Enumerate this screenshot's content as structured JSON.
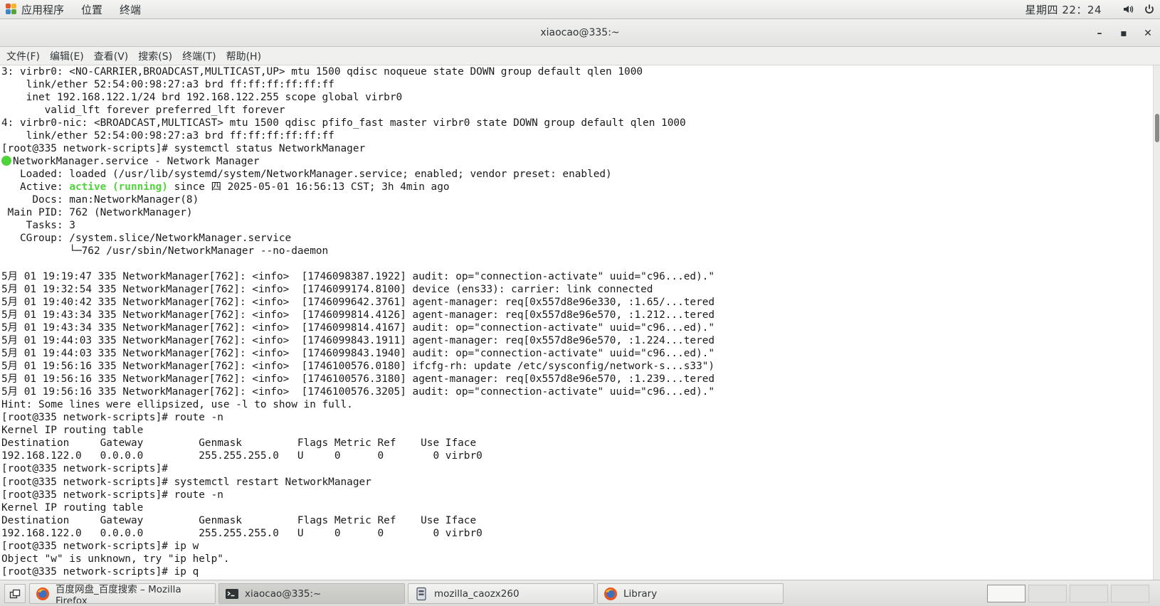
{
  "topbar": {
    "applications": "应用程序",
    "places": "位置",
    "terminal": "终端",
    "clock": "星期四 22：24",
    "volume_icon": "volume-icon",
    "power_icon": "power-icon"
  },
  "window": {
    "title": "xiaocao@335:~",
    "minimize": "–",
    "maximize": "▪",
    "close": "✕"
  },
  "menu": [
    "文件(F)",
    "编辑(E)",
    "查看(V)",
    "搜索(S)",
    "终端(T)",
    "帮助(H)"
  ],
  "terminal_lines": [
    "3: virbr0: <NO-CARRIER,BROADCAST,MULTICAST,UP> mtu 1500 qdisc noqueue state DOWN group default qlen 1000",
    "    link/ether 52:54:00:98:27:a3 brd ff:ff:ff:ff:ff:ff",
    "    inet 192.168.122.1/24 brd 192.168.122.255 scope global virbr0",
    "       valid_lft forever preferred_lft forever",
    "4: virbr0-nic: <BROADCAST,MULTICAST> mtu 1500 qdisc pfifo_fast master virbr0 state DOWN group default qlen 1000",
    "    link/ether 52:54:00:98:27:a3 brd ff:ff:ff:ff:ff:ff",
    "[root@335 network-scripts]# systemctl status NetworkManager",
    "NetworkManager.service - Network Manager",
    "   Loaded: loaded (/usr/lib/systemd/system/NetworkManager.service; enabled; vendor preset: enabled)",
    "   Active: ",
    "active (running)",
    " since 四 2025-05-01 16:56:13 CST; 3h 4min ago",
    "     Docs: man:NetworkManager(8)",
    " Main PID: 762 (NetworkManager)",
    "    Tasks: 3",
    "   CGroup: /system.slice/NetworkManager.service",
    "           └─762 /usr/sbin/NetworkManager --no-daemon",
    "",
    "5月 01 19:19:47 335 NetworkManager[762]: <info>  [1746098387.1922] audit: op=\"connection-activate\" uuid=\"c96...ed).\"",
    "5月 01 19:32:54 335 NetworkManager[762]: <info>  [1746099174.8100] device (ens33): carrier: link connected",
    "5月 01 19:40:42 335 NetworkManager[762]: <info>  [1746099642.3761] agent-manager: req[0x557d8e96e330, :1.65/...tered",
    "5月 01 19:43:34 335 NetworkManager[762]: <info>  [1746099814.4126] agent-manager: req[0x557d8e96e570, :1.212...tered",
    "5月 01 19:43:34 335 NetworkManager[762]: <info>  [1746099814.4167] audit: op=\"connection-activate\" uuid=\"c96...ed).\"",
    "5月 01 19:44:03 335 NetworkManager[762]: <info>  [1746099843.1911] agent-manager: req[0x557d8e96e570, :1.224...tered",
    "5月 01 19:44:03 335 NetworkManager[762]: <info>  [1746099843.1940] audit: op=\"connection-activate\" uuid=\"c96...ed).\"",
    "5月 01 19:56:16 335 NetworkManager[762]: <info>  [1746100576.0180] ifcfg-rh: update /etc/sysconfig/network-s...s33\")",
    "5月 01 19:56:16 335 NetworkManager[762]: <info>  [1746100576.3180] agent-manager: req[0x557d8e96e570, :1.239...tered",
    "5月 01 19:56:16 335 NetworkManager[762]: <info>  [1746100576.3205] audit: op=\"connection-activate\" uuid=\"c96...ed).\"",
    "Hint: Some lines were ellipsized, use -l to show in full.",
    "[root@335 network-scripts]# route -n",
    "Kernel IP routing table",
    "Destination     Gateway         Genmask         Flags Metric Ref    Use Iface",
    "192.168.122.0   0.0.0.0         255.255.255.0   U     0      0        0 virbr0",
    "[root@335 network-scripts]#",
    "[root@335 network-scripts]# systemctl restart NetworkManager",
    "[root@335 network-scripts]# route -n",
    "Kernel IP routing table",
    "Destination     Gateway         Genmask         Flags Metric Ref    Use Iface",
    "192.168.122.0   0.0.0.0         255.255.255.0   U     0      0        0 virbr0",
    "[root@335 network-scripts]# ip w",
    "Object \"w\" is unknown, try \"ip help\".",
    "[root@335 network-scripts]# ip q"
  ],
  "colors": {
    "status_dot": "#4fd33a",
    "active_running": "#4fd33a",
    "terminal_bg": "#ffffff",
    "terminal_fg": "#1a1a1a"
  },
  "taskbar": {
    "show_desktop_icon": "show-desktop-icon",
    "tasks": [
      {
        "label": "百度网盘_百度搜索 – Mozilla Firefox",
        "icon": "firefox-icon"
      },
      {
        "label": "xiaocao@335:~",
        "icon": "terminal-icon"
      },
      {
        "label": "mozilla_caozx260",
        "icon": "file-manager-icon"
      },
      {
        "label": "Library",
        "icon": "firefox-icon"
      }
    ]
  }
}
